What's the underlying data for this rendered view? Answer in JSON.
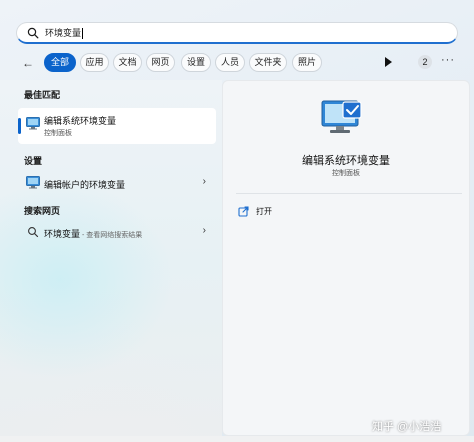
{
  "search": {
    "query": "环境变量"
  },
  "filters": {
    "chips": [
      "全部",
      "应用",
      "文档",
      "网页",
      "设置",
      "人员",
      "文件夹",
      "照片"
    ],
    "active_index": 0,
    "count_badge": "2",
    "more": "···"
  },
  "left": {
    "best_match_heading": "最佳匹配",
    "best_match": {
      "title": "编辑系统环境变量",
      "subtitle": "控制面板",
      "icon": "control-panel-monitor-icon"
    },
    "settings_heading": "设置",
    "settings_item": {
      "label": "编辑帐户的环境变量",
      "icon": "control-panel-monitor-icon"
    },
    "web_heading": "搜索网页",
    "web_item": {
      "label": "环境变量",
      "suffix": " - 查看网络搜索结果",
      "icon": "search-icon"
    }
  },
  "right": {
    "title": "编辑系统环境变量",
    "subtitle": "控制面板",
    "open_label": "打开",
    "icon": "control-panel-monitor-icon"
  },
  "watermark": "知乎 @小浩浩",
  "colors": {
    "accent": "#0b63cb",
    "panel": "#f4f6f8"
  }
}
